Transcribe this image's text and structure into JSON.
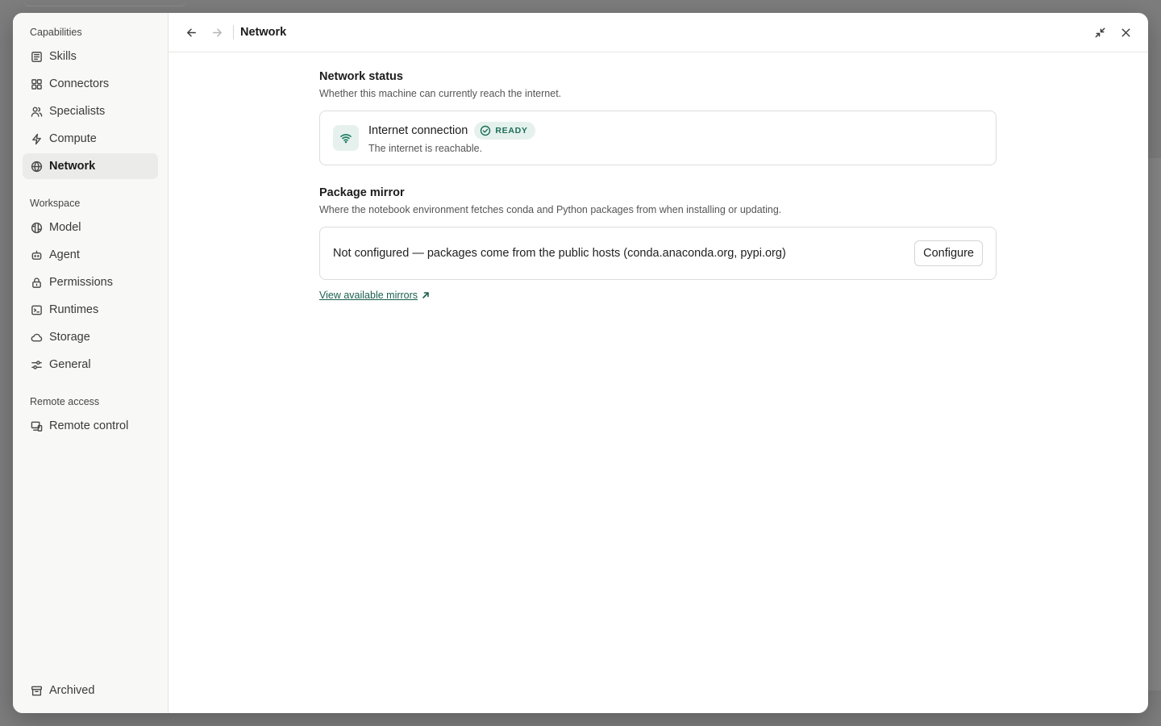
{
  "sidebar": {
    "sections": [
      {
        "label": "Capabilities",
        "items": [
          {
            "label": "Skills",
            "icon": "skills-icon"
          },
          {
            "label": "Connectors",
            "icon": "connectors-icon"
          },
          {
            "label": "Specialists",
            "icon": "specialists-icon"
          },
          {
            "label": "Compute",
            "icon": "lightning-icon"
          },
          {
            "label": "Network",
            "icon": "globe-icon",
            "active": true
          }
        ]
      },
      {
        "label": "Workspace",
        "items": [
          {
            "label": "Model",
            "icon": "model-icon"
          },
          {
            "label": "Agent",
            "icon": "robot-icon"
          },
          {
            "label": "Permissions",
            "icon": "lock-icon"
          },
          {
            "label": "Runtimes",
            "icon": "terminal-icon"
          },
          {
            "label": "Storage",
            "icon": "cloud-icon"
          },
          {
            "label": "General",
            "icon": "sliders-icon"
          }
        ]
      },
      {
        "label": "Remote access",
        "items": [
          {
            "label": "Remote control",
            "icon": "remote-control-icon"
          }
        ]
      }
    ],
    "bottom_item": {
      "label": "Archived",
      "icon": "archive-icon"
    }
  },
  "header": {
    "title": "Network"
  },
  "network_status": {
    "heading": "Network status",
    "description": "Whether this machine can currently reach the internet.",
    "connection_title": "Internet connection",
    "badge": "READY",
    "connection_subtitle": "The internet is reachable."
  },
  "package_mirror": {
    "heading": "Package mirror",
    "description": "Where the notebook environment fetches conda and Python packages from when installing or updating.",
    "status_text": "Not configured — packages come from the public hosts (conda.anaconda.org, pypi.org)",
    "configure_label": "Configure",
    "link_label": "View available mirrors"
  },
  "colors": {
    "accent": "#1d6e57",
    "badge_bg": "#e5f1ed",
    "sidebar_bg": "#f8f8f7",
    "active_item_bg": "#ebebe9"
  }
}
